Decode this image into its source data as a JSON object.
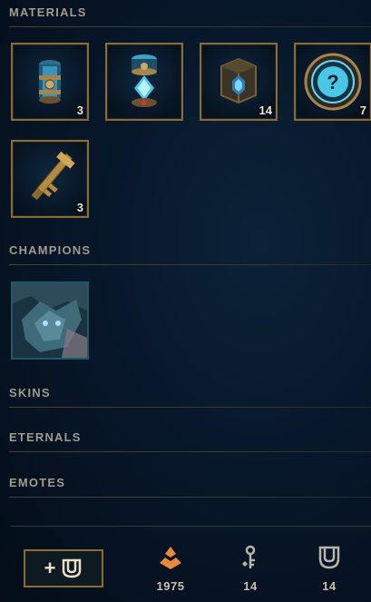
{
  "sections": {
    "materials": "MATERIALS",
    "champions": "CHAMPIONS",
    "skins": "SKINS",
    "eternals": "ETERNALS",
    "emotes": "EMOTES"
  },
  "materials": [
    {
      "name": "capsule",
      "count": "3"
    },
    {
      "name": "hextech-chest-capsule",
      "count": ""
    },
    {
      "name": "masterwork-chest",
      "count": "14"
    },
    {
      "name": "mystery-orb",
      "count": "7"
    },
    {
      "name": "hextech-key-fragment",
      "count": "3"
    }
  ],
  "champions": [
    {
      "name": "champion-shard"
    }
  ],
  "footer": {
    "craft_plus": "+",
    "currencies": [
      {
        "icon": "orange-essence-icon",
        "value": "1975",
        "color": "#e7883a"
      },
      {
        "icon": "key-icon",
        "value": "14",
        "color": "#b8b4a8"
      },
      {
        "icon": "chest-icon",
        "value": "14",
        "color": "#b8b4a8"
      }
    ]
  },
  "colors": {
    "gold_border": "#8a6d32",
    "section_text": "#a09b8c",
    "count_text": "#f0e6d2",
    "champion_border": "#1e5a63"
  }
}
